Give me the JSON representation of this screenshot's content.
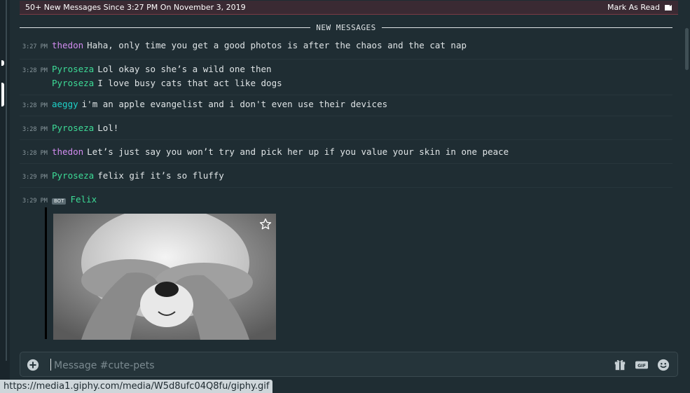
{
  "banner": {
    "text": "50+ New Messages Since 3:27 PM On November 3, 2019",
    "action": "Mark As Read",
    "color": "#3a2a33"
  },
  "divider": {
    "label": "NEW MESSAGES"
  },
  "messages": [
    {
      "time": "3:27",
      "ampm": "PM",
      "author": "thedon",
      "author_color": "#d28cf0",
      "lines": [
        "Haha, only time you get a good photos is after the chaos and the cat nap"
      ]
    },
    {
      "time": "3:28",
      "ampm": "PM",
      "author": "Pyroseza",
      "author_color": "#3ddc97",
      "lines": [
        "Lol okay so she’s a wild one then",
        "I love busy cats that act like dogs"
      ]
    },
    {
      "time": "3:28",
      "ampm": "PM",
      "author": "aeggy",
      "author_color": "#1fd1c8",
      "lines": [
        "i'm an apple evangelist and i don't even use their devices"
      ]
    },
    {
      "time": "3:28",
      "ampm": "PM",
      "author": "Pyroseza",
      "author_color": "#3ddc97",
      "lines": [
        "Lol!"
      ]
    },
    {
      "time": "3:28",
      "ampm": "PM",
      "author": "thedon",
      "author_color": "#d28cf0",
      "lines": [
        "Let’s just say you won’t try and pick her up if you value your skin in one peace"
      ]
    },
    {
      "time": "3:29",
      "ampm": "PM",
      "author": "Pyroseza",
      "author_color": "#3ddc97",
      "lines": [
        "felix gif it’s so fluffy"
      ]
    },
    {
      "time": "3:29",
      "ampm": "PM",
      "author": "Felix",
      "author_color": "#3ddc97",
      "bot_tag": "BOT",
      "lines": []
    }
  ],
  "embed": {
    "image_icon": "puppy-gif",
    "favorite_icon": "star-icon"
  },
  "composer": {
    "placeholder": "Message #cute-pets",
    "icons": [
      "plus-icon",
      "gift-icon",
      "gif-icon",
      "emoji-icon"
    ],
    "gif_label": "GIF"
  },
  "status_bar": {
    "url": "https://media1.giphy.com/media/W5d8ufc04Q8fu/giphy.gif"
  },
  "colors": {
    "background": "#1f2d33",
    "text": "#dfe4e6",
    "muted": "#8a989e"
  }
}
